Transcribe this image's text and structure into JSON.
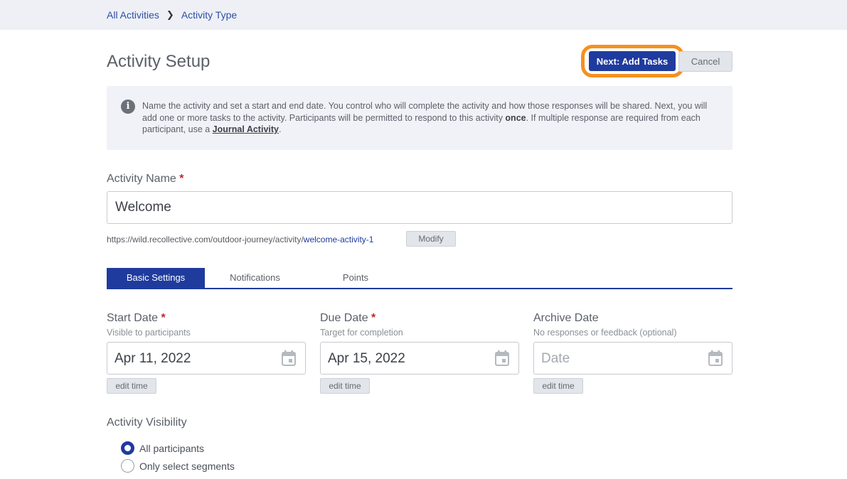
{
  "breadcrumb": {
    "items": [
      "All Activities",
      "Activity Type"
    ],
    "separator": "❯"
  },
  "header": {
    "title": "Activity Setup",
    "primary_label": "Next: Add Tasks",
    "cancel_label": "Cancel"
  },
  "info": {
    "icon": "info-icon",
    "part1": "Name the activity and set a start and end date. You control who will complete the activity and how those responses will be shared. Next, you will add one or more tasks to the activity. Participants will be permitted to respond to this activity ",
    "emphasis": "once",
    "part2": ". If multiple response are required from each participant, use a ",
    "link": "Journal Activity",
    "part3": "."
  },
  "activity_name": {
    "label": "Activity Name",
    "required": "*",
    "value": "Welcome",
    "url_prefix": "https://wild.recollective.com/outdoor-journey/activity/",
    "url_slug": "welcome-activity-1",
    "modify_label": "Modify"
  },
  "tabs": [
    "Basic Settings",
    "Notifications",
    "Points"
  ],
  "dates": {
    "start": {
      "title": "Start Date",
      "required": "*",
      "subtitle": "Visible to participants",
      "value": "Apr 11, 2022",
      "edit": "edit time"
    },
    "due": {
      "title": "Due Date",
      "required": "*",
      "subtitle": "Target for completion",
      "value": "Apr 15, 2022",
      "edit": "edit time"
    },
    "archive": {
      "title": "Archive Date",
      "subtitle": "No responses or feedback (optional)",
      "placeholder": "Date",
      "edit": "edit time"
    }
  },
  "visibility": {
    "label": "Activity Visibility",
    "options": [
      {
        "label": "All participants",
        "selected": true
      },
      {
        "label": "Only select segments",
        "selected": false
      }
    ]
  },
  "colors": {
    "primary": "#1f3b9e",
    "highlight": "#f5901f",
    "required": "#c0272d"
  }
}
